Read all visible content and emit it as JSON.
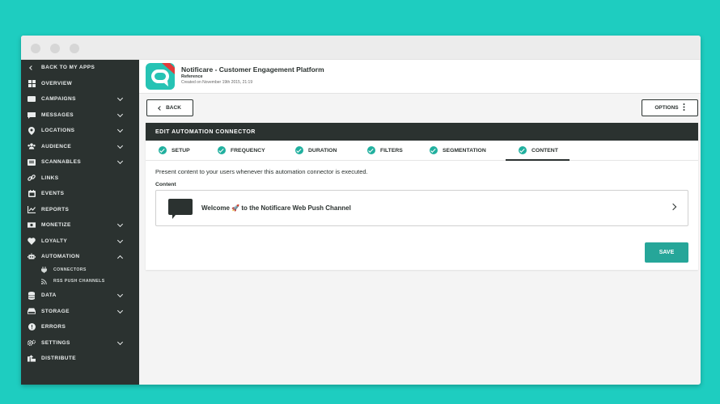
{
  "colors": {
    "background": "#1ecdc0",
    "sidebar": "#2b3230",
    "accent": "#26a699",
    "check": "#21b09f"
  },
  "sidebar": {
    "items": [
      {
        "label": "BACK TO MY APPS",
        "icon": "chevron-left-icon"
      },
      {
        "label": "OVERVIEW",
        "icon": "grid-icon"
      },
      {
        "label": "CAMPAIGNS",
        "icon": "campaign-icon"
      },
      {
        "label": "MESSAGES",
        "icon": "message-icon"
      },
      {
        "label": "LOCATIONS",
        "icon": "location-pin-icon"
      },
      {
        "label": "AUDIENCE",
        "icon": "users-icon"
      },
      {
        "label": "SCANNABLES",
        "icon": "scannable-icon"
      },
      {
        "label": "LINKS",
        "icon": "link-icon"
      },
      {
        "label": "EVENTS",
        "icon": "calendar-icon"
      },
      {
        "label": "REPORTS",
        "icon": "chart-icon"
      },
      {
        "label": "MONETIZE",
        "icon": "money-icon"
      },
      {
        "label": "LOYALTY",
        "icon": "heart-icon"
      },
      {
        "label": "AUTOMATION",
        "icon": "robot-icon"
      },
      {
        "label": "DATA",
        "icon": "database-icon"
      },
      {
        "label": "STORAGE",
        "icon": "storage-icon"
      },
      {
        "label": "ERRORS",
        "icon": "error-icon"
      },
      {
        "label": "SETTINGS",
        "icon": "gear-icon"
      },
      {
        "label": "DISTRIBUTE",
        "icon": "distribute-icon"
      }
    ],
    "subitems": [
      {
        "label": "CONNECTORS",
        "icon": "plug-icon"
      },
      {
        "label": "RSS PUSH CHANNELS",
        "icon": "rss-icon"
      }
    ]
  },
  "header": {
    "title": "Notificare - Customer Engagement Platform",
    "subtitle": "Reference",
    "created": "Created on November 19th 2015, 21:19"
  },
  "toolbar": {
    "back_label": "BACK",
    "options_label": "OPTIONS"
  },
  "panel": {
    "title": "EDIT AUTOMATION CONNECTOR",
    "tabs": [
      {
        "label": "SETUP"
      },
      {
        "label": "FREQUENCY"
      },
      {
        "label": "DURATION"
      },
      {
        "label": "FILTERS"
      },
      {
        "label": "SEGMENTATION"
      },
      {
        "label": "CONTENT"
      }
    ],
    "active_tab": "CONTENT",
    "description": "Present content to your users whenever this automation connector is executed.",
    "content_label": "Content",
    "content_item": "Welcome 🚀 to the Notificare Web Push Channel",
    "save_label": "SAVE"
  }
}
